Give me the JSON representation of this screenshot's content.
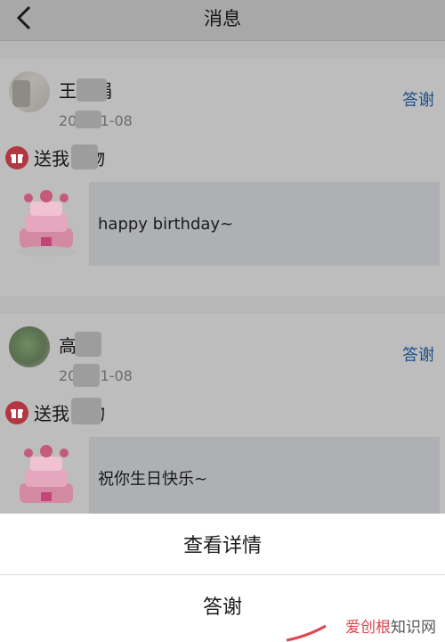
{
  "header": {
    "title": "消息"
  },
  "messages": [
    {
      "name": "王　娟",
      "date": "20　11-08",
      "thank_label": "答谢",
      "gift_text": "送我　物",
      "message": "happy birthday~"
    },
    {
      "name": "高",
      "date": "20　11-08",
      "thank_label": "答谢",
      "gift_text": "送我　物",
      "message": "祝你生日快乐~"
    }
  ],
  "action_sheet": {
    "view_details": "查看详情",
    "thank": "答谢"
  },
  "watermark": {
    "part_a": "爱创根",
    "part_b": "知识网"
  },
  "colors": {
    "link": "#1e4f88",
    "gift_icon": "#b23740",
    "sheet_bg": "#ffffff",
    "overlay_bg": "#b7b7b7"
  }
}
